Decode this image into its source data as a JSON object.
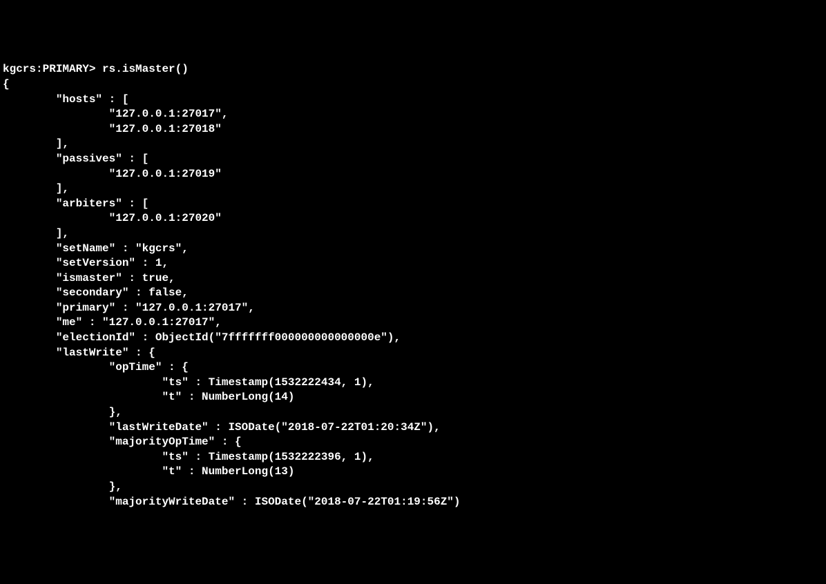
{
  "prompt": "kgcrs:PRIMARY> ",
  "command": "rs.isMaster()",
  "lines": {
    "l0": "{",
    "l1": "        \"hosts\" : [",
    "l2": "                \"127.0.0.1:27017\",",
    "l3": "                \"127.0.0.1:27018\"",
    "l4": "        ],",
    "l5": "        \"passives\" : [",
    "l6": "                \"127.0.0.1:27019\"",
    "l7": "        ],",
    "l8": "        \"arbiters\" : [",
    "l9": "                \"127.0.0.1:27020\"",
    "l10": "        ],",
    "l11": "        \"setName\" : \"kgcrs\",",
    "l12": "        \"setVersion\" : 1,",
    "l13": "        \"ismaster\" : true,",
    "l14": "        \"secondary\" : false,",
    "l15": "        \"primary\" : \"127.0.0.1:27017\",",
    "l16": "        \"me\" : \"127.0.0.1:27017\",",
    "l17": "        \"electionId\" : ObjectId(\"7fffffff000000000000000e\"),",
    "l18": "        \"lastWrite\" : {",
    "l19": "                \"opTime\" : {",
    "l20": "                        \"ts\" : Timestamp(1532222434, 1),",
    "l21": "                        \"t\" : NumberLong(14)",
    "l22": "                },",
    "l23": "                \"lastWriteDate\" : ISODate(\"2018-07-22T01:20:34Z\"),",
    "l24": "                \"majorityOpTime\" : {",
    "l25": "                        \"ts\" : Timestamp(1532222396, 1),",
    "l26": "                        \"t\" : NumberLong(13)",
    "l27": "                },",
    "l28": "                \"majorityWriteDate\" : ISODate(\"2018-07-22T01:19:56Z\")"
  }
}
